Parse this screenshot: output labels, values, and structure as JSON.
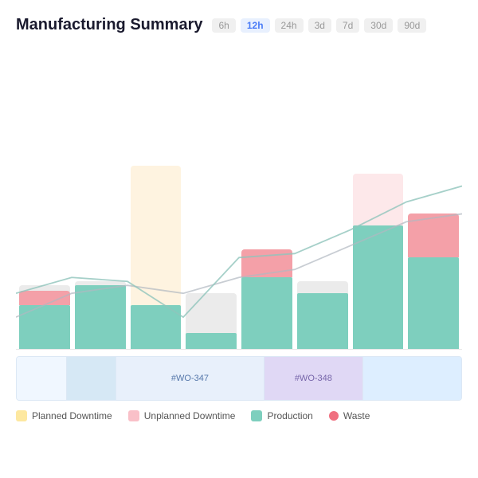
{
  "header": {
    "title": "Manufacturing Summary",
    "time_filters": [
      "6h",
      "12h",
      "24h",
      "3d",
      "7d",
      "30d",
      "90d"
    ],
    "active_filter": "12h"
  },
  "chart": {
    "bar_groups": [
      {
        "id": 1,
        "production_h": 55,
        "waste_h": 18,
        "bg_h": 80,
        "bg_type": "grey"
      },
      {
        "id": 2,
        "production_h": 80,
        "waste_h": 0,
        "bg_h": 85,
        "bg_type": "grey"
      },
      {
        "id": 3,
        "production_h": 55,
        "waste_h": 0,
        "bg_h": 230,
        "bg_type": "planned"
      },
      {
        "id": 4,
        "production_h": 20,
        "waste_h": 0,
        "bg_h": 70,
        "bg_type": "grey"
      },
      {
        "id": 5,
        "production_h": 90,
        "waste_h": 35,
        "bg_h": 110,
        "bg_type": "grey"
      },
      {
        "id": 6,
        "production_h": 70,
        "waste_h": 0,
        "bg_h": 85,
        "bg_type": "grey"
      },
      {
        "id": 7,
        "production_h": 155,
        "waste_h": 0,
        "bg_h": 220,
        "bg_type": "unplanned"
      },
      {
        "id": 8,
        "production_h": 115,
        "waste_h": 55,
        "bg_h": 130,
        "bg_type": "grey"
      }
    ]
  },
  "timeline": {
    "segments": [
      {
        "label": "",
        "flex": 1,
        "style": "grey"
      },
      {
        "label": "",
        "flex": 1,
        "style": "blue-light"
      },
      {
        "label": "#WO-347",
        "flex": 3,
        "style": "wo"
      },
      {
        "label": "#WO-348",
        "flex": 2,
        "style": "purple"
      },
      {
        "label": "",
        "flex": 2,
        "style": "light-blue"
      }
    ]
  },
  "legend": {
    "items": [
      {
        "key": "planned_downtime",
        "label": "Planned Downtime",
        "color_class": "dot-planned"
      },
      {
        "key": "unplanned_downtime",
        "label": "Unplanned Downtime",
        "color_class": "dot-unplanned"
      },
      {
        "key": "production",
        "label": "Production",
        "color_class": "dot-production"
      },
      {
        "key": "waste",
        "label": "Waste",
        "color_class": "dot-waste"
      }
    ]
  }
}
